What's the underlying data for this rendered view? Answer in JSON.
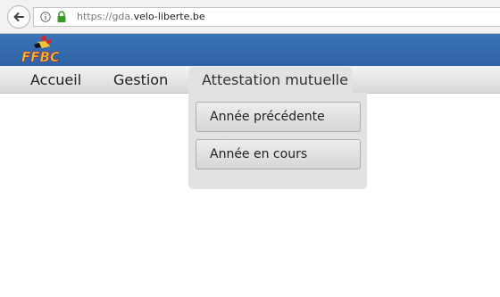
{
  "browser": {
    "url_scheme": "https://",
    "url_host_prefix": "gda.",
    "url_host_main": "velo-liberte.be"
  },
  "site": {
    "logo_text": "FFBC"
  },
  "nav": {
    "items": [
      {
        "label": "Accueil"
      },
      {
        "label": "Gestion"
      },
      {
        "label": "Attestation mutuelle",
        "active": true
      }
    ]
  },
  "dropdown": {
    "items": [
      {
        "label": "Année précédente"
      },
      {
        "label": "Année en cours"
      }
    ]
  },
  "colors": {
    "header_blue": "#3b73b7",
    "nav_gray": "#e2e2e2",
    "lock_green": "#3a9a2a"
  }
}
